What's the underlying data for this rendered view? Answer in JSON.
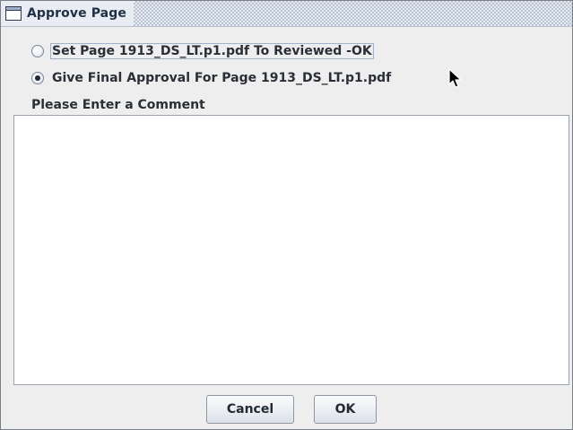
{
  "window": {
    "title": "Approve Page",
    "icon": "window-icon"
  },
  "options": [
    {
      "label": "Set Page 1913_DS_LT.p1.pdf To Reviewed -OK",
      "selected": false,
      "focused": true
    },
    {
      "label": "Give Final Approval For Page 1913_DS_LT.p1.pdf",
      "selected": true,
      "focused": false
    }
  ],
  "comment": {
    "label": "Please Enter a Comment",
    "value": ""
  },
  "buttons": {
    "cancel_label": "Cancel",
    "ok_label": "OK"
  },
  "colors": {
    "dialog_background": "#eeeeee",
    "title_text": "#1f2f46",
    "button_border": "#8d96a3"
  }
}
